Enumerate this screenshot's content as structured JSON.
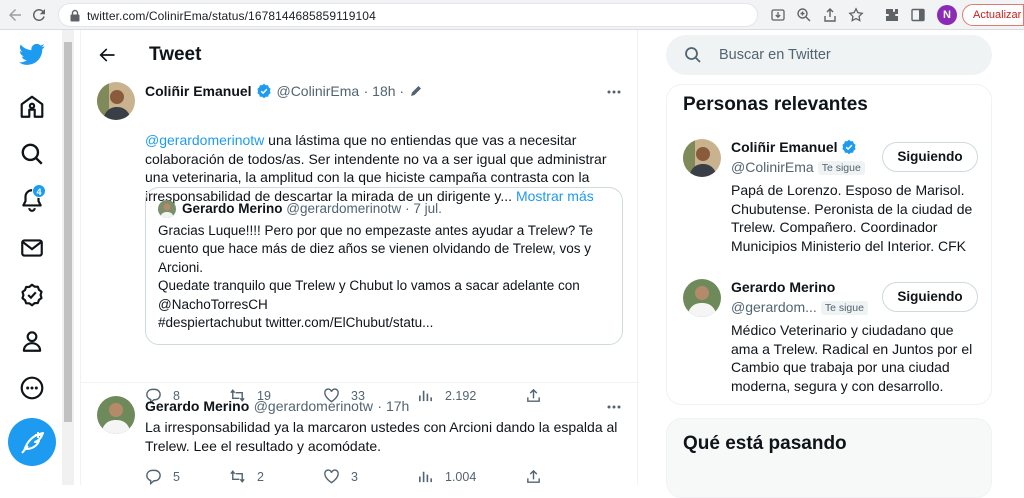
{
  "browser": {
    "url": "twitter.com/ColinirEma/status/1678144685859119104",
    "profile_initial": "N",
    "update_label": "Actualizar"
  },
  "nav": {
    "notifications_badge": "4",
    "items": [
      "twitter-logo",
      "home-icon",
      "explore-icon",
      "notifications-icon",
      "messages-icon",
      "verified-icon",
      "profile-icon",
      "more-icon"
    ]
  },
  "header": {
    "title": "Tweet"
  },
  "main_tweet": {
    "name": "Coliñir Emanuel",
    "handle": "@ColinirEma",
    "time": "· 18h ·",
    "mention": "@gerardomerinotw",
    "text": " una lástima que no entiendas que vas a necesitar colaboración de todos/as. Ser intendente no va a ser igual que administrar una veterinaria, la amplitud con la que hiciste campaña contrasta con la irresponsabilidad de descartar la mirada de un dirigente y...",
    "show_more": "Mostrar más",
    "quote": {
      "name": "Gerardo Merino",
      "handle": "@gerardomerinotw",
      "time": "· 7 jul.",
      "line1": "Gracias Luque!!!! Pero por que no empezaste antes ayudar a Trelew? Te cuento que hace más de diez años se vienen olvidando de Trelew, vos y Arcioni.",
      "line2": "Quedate tranquilo que Trelew y Chubut lo vamos a sacar adelante con @NachoTorresCH",
      "line3": "#despiertachubut twitter.com/ElChubut/statu..."
    },
    "replies": "8",
    "retweets": "19",
    "likes": "33",
    "views": "2.192"
  },
  "reply_tweet": {
    "name": "Gerardo Merino",
    "handle": "@gerardomerinotw",
    "time": "· 17h",
    "text": "La irresponsabilidad ya la marcaron ustedes con Arcioni dando la espalda al Trelew. Lee el resultado y acomódate.",
    "replies": "5",
    "retweets": "2",
    "likes": "3",
    "views": "1.004"
  },
  "sidebar": {
    "search_placeholder": "Buscar en Twitter",
    "relevant_title": "Personas relevantes",
    "people": [
      {
        "name": "Coliñir Emanuel",
        "handle": "@ColinirEma",
        "follows_you": "Te sigue",
        "button": "Siguiendo",
        "bio": "Papá de Lorenzo. Esposo de Marisol. Chubutense. Peronista de la ciudad de Trelew. Compañero. Coordinador Municipios Ministerio del Interior. CFK"
      },
      {
        "name": "Gerardo Merino",
        "handle": "@gerardom...",
        "follows_you": "Te sigue",
        "button": "Siguiendo",
        "bio": "Médico Veterinario y ciudadano que ama a Trelew. Radical en Juntos por el Cambio que trabaja por una ciudad moderna, segura y con desarrollo."
      }
    ],
    "trending_title": "Qué está pasando"
  },
  "colors": {
    "accent": "#1d9bf0",
    "text": "#0f1419",
    "muted": "#536471"
  }
}
